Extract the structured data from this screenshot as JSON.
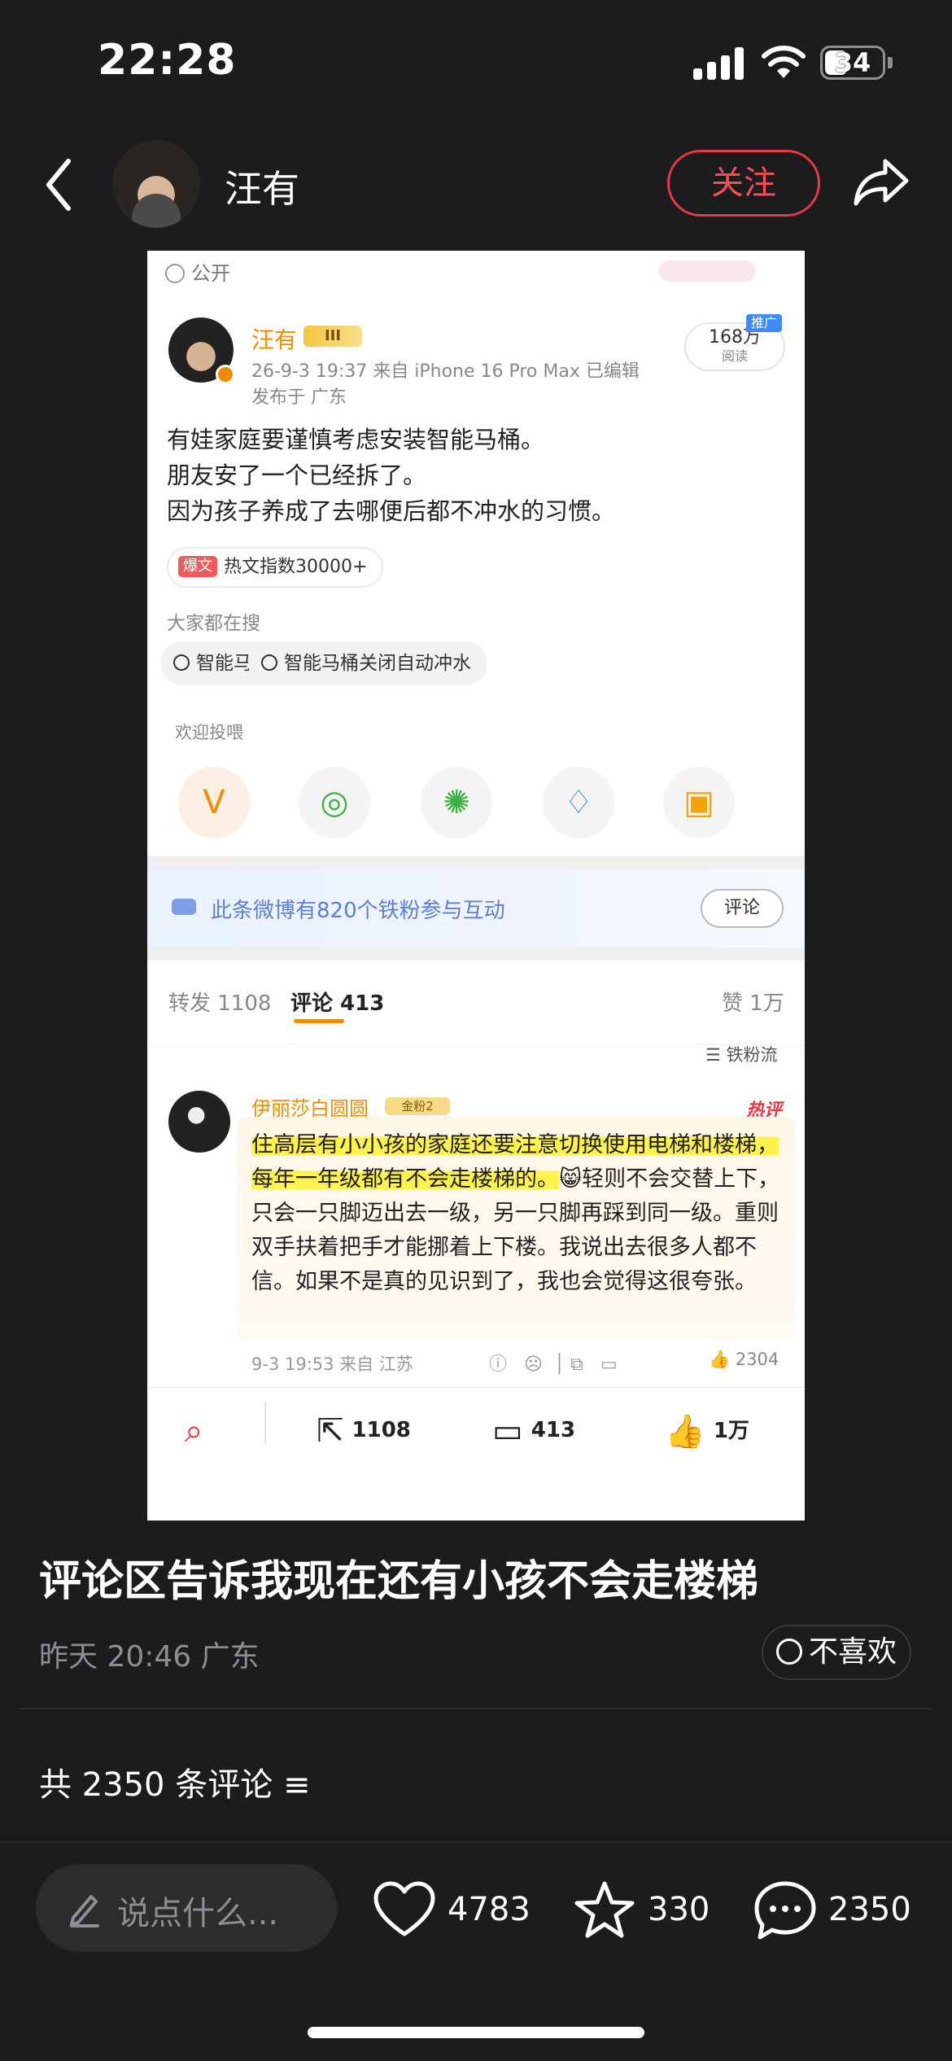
{
  "status": {
    "time": "22:28",
    "battery": "34"
  },
  "header": {
    "username": "汪有",
    "follow_label": "关注"
  },
  "card": {
    "visibility": "公开",
    "author": "汪有",
    "author_badge": "III",
    "meta": "26-9-3 19:37  来自 iPhone 16 Pro Max  已编辑",
    "location": "发布于 广东",
    "reads_value": "168万",
    "reads_label": "阅读",
    "promo_tag": "推广",
    "post_lines": [
      "有娃家庭要谨慎考虑安装智能马桶。",
      "朋友安了一个已经拆了。",
      "因为孩子养成了去哪便后都不冲水的习惯。"
    ],
    "hot_tag": "爆文",
    "hot_index": "热文指数30000+",
    "search_label": "大家都在搜",
    "search_pills": [
      "智能马桶",
      "智能马桶关闭自动冲水"
    ],
    "feed_label": "欢迎投喂",
    "fans_text": "此条微博有820个铁粉参与互动",
    "fans_button": "评论",
    "tabs": {
      "repost": "转发 1108",
      "comment": "评论 413",
      "like": "赞 1万"
    },
    "sort_label": "铁粉流",
    "comment": {
      "author": "伊丽莎白圆圆",
      "badge": "金粉2",
      "hot_mark": "热评",
      "text_highlight": "住高层有小小孩的家庭还要注意切换使用电梯和楼梯，每年一年级都有不会走楼梯的。",
      "text_rest": "😸轻则不会交替上下，只会一只脚迈出去一级，另一只脚再踩到同一级。重则双手扶着把手才能挪着上下楼。我说出去很多人都不信。如果不是真的见识到了，我也会觉得这很夸张。",
      "meta": "9-3 19:53  来自 江苏",
      "likes": "2304"
    },
    "bottom": {
      "repost": "1108",
      "comment": "413",
      "like": "1万"
    }
  },
  "post": {
    "title": "评论区告诉我现在还有小孩不会走楼梯",
    "meta": "昨天 20:46 广东",
    "dislike_label": "不喜欢",
    "comment_count": "共 2350 条评论"
  },
  "bottombar": {
    "input_placeholder": "说点什么...",
    "likes": "4783",
    "stars": "330",
    "comments": "2350"
  }
}
